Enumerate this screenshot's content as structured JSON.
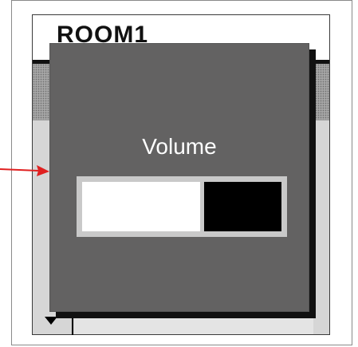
{
  "room": {
    "title": "ROOM1"
  },
  "volume_popup": {
    "label": "Volume",
    "level_fraction": 0.6
  },
  "colors": {
    "popup_background": "#636262",
    "popup_shadow": "#111111",
    "pointer_arrow": "#e02020",
    "level_filled": "#ffffff",
    "level_empty": "#000000",
    "bar_frame": "#c9c9c9"
  },
  "icons": {
    "pointer": "red-arrow-right",
    "scroll": "triangle-down"
  }
}
